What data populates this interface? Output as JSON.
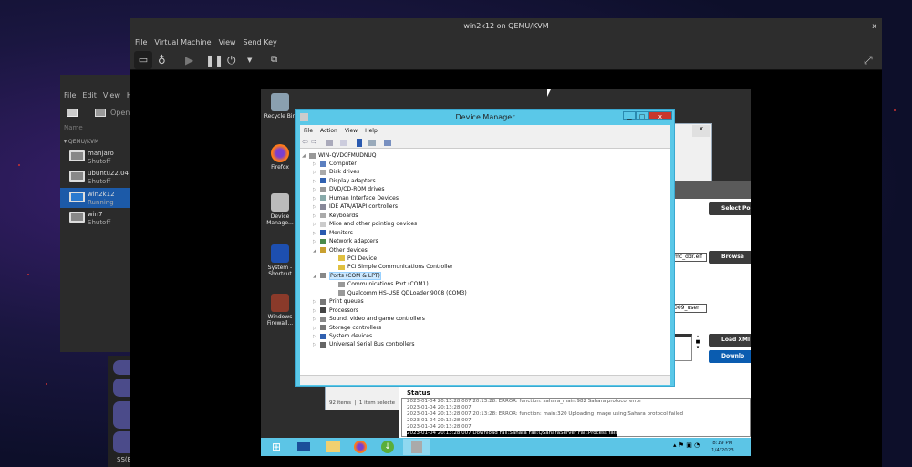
{
  "virt_manager": {
    "menu": [
      "File",
      "Edit",
      "View",
      "H"
    ],
    "open_label": "Open",
    "name_header": "Name",
    "group": "QEMU/KVM",
    "vms": [
      {
        "name": "manjaro",
        "state": "Shutoff"
      },
      {
        "name": "ubuntu22.04",
        "state": "Shutoff"
      },
      {
        "name": "win2k12",
        "state": "Running",
        "selected": true
      },
      {
        "name": "win7",
        "state": "Shutoff"
      }
    ]
  },
  "dock": {
    "label": "SS(E"
  },
  "viewer": {
    "title": "win2k12 on QEMU/KVM",
    "close": "x",
    "menu": [
      "File",
      "Virtual Machine",
      "View",
      "Send Key"
    ],
    "toolbar": [
      "monitor-icon",
      "lightbulb-icon",
      "play-icon",
      "pause-icon",
      "power-icon",
      "dropdown-icon",
      "screenshot-icon",
      "fullscreen-icon"
    ]
  },
  "guest": {
    "desktop_icons": [
      "Recycle Bin",
      "Firefox",
      "Device Manage...",
      "System - Shortcut",
      "Windows Firewall..."
    ],
    "explorer": {
      "items_count": "92 items",
      "selected": "1 item selecte"
    },
    "tool": {
      "select_port": "Select Po",
      "browse": "Browse",
      "load_xml": "Load XMl",
      "download": "Downlo",
      "field1": "mc_ddr.elf",
      "field2": "009_user",
      "status_title": "Status",
      "status_lines": [
        "2023-01-04 20:13:28.007    20:13:28: ERROR: function: sahara_main:982 Sahara protocol error",
        "2023-01-04 20:13:28.007",
        "2023-01-04 20:13:28.007    20:13:28: ERROR: function: main:320 Uploading  Image using Sahara protocol failed",
        "2023-01-04 20:13:28.007",
        "2023-01-04 20:13:28.007"
      ],
      "status_highlight": "2023-01-04 20:13:28.007    Download Fail:Sahara Fail:QSaharaServer Fail:Process fail"
    },
    "device_manager": {
      "title": "Device Manager",
      "menu": [
        "File",
        "Action",
        "View",
        "Help"
      ],
      "root": "WIN-QVDCFMUDNUQ",
      "tree": [
        {
          "label": "Computer",
          "level": 1,
          "exp": "▷"
        },
        {
          "label": "Disk drives",
          "level": 1,
          "exp": "▷"
        },
        {
          "label": "Display adapters",
          "level": 1,
          "exp": "▷"
        },
        {
          "label": "DVD/CD-ROM drives",
          "level": 1,
          "exp": "▷"
        },
        {
          "label": "Human Interface Devices",
          "level": 1,
          "exp": "▷"
        },
        {
          "label": "IDE ATA/ATAPI controllers",
          "level": 1,
          "exp": "▷"
        },
        {
          "label": "Keyboards",
          "level": 1,
          "exp": "▷"
        },
        {
          "label": "Mice and other pointing devices",
          "level": 1,
          "exp": "▷"
        },
        {
          "label": "Monitors",
          "level": 1,
          "exp": "▷"
        },
        {
          "label": "Network adapters",
          "level": 1,
          "exp": "▷"
        },
        {
          "label": "Other devices",
          "level": 1,
          "exp": "◢"
        },
        {
          "label": "PCI Device",
          "level": 2,
          "exp": ""
        },
        {
          "label": "PCI Simple Communications Controller",
          "level": 2,
          "exp": ""
        },
        {
          "label": "Ports (COM & LPT)",
          "level": 1,
          "exp": "◢",
          "selected": true
        },
        {
          "label": "Communications Port (COM1)",
          "level": 2,
          "exp": ""
        },
        {
          "label": "Qualcomm HS-USB QDLoader 9008 (COM3)",
          "level": 2,
          "exp": ""
        },
        {
          "label": "Print queues",
          "level": 1,
          "exp": "▷"
        },
        {
          "label": "Processors",
          "level": 1,
          "exp": "▷"
        },
        {
          "label": "Sound, video and game controllers",
          "level": 1,
          "exp": "▷"
        },
        {
          "label": "Storage controllers",
          "level": 1,
          "exp": "▷"
        },
        {
          "label": "System devices",
          "level": 1,
          "exp": "▷"
        },
        {
          "label": "Universal Serial Bus controllers",
          "level": 1,
          "exp": "▷"
        }
      ]
    },
    "clock": {
      "time": "8:19 PM",
      "date": "1/4/2023"
    }
  },
  "colors": {
    "accent": "#5ac8e8",
    "selection": "#1c5aa8",
    "download": "#0a5cb0"
  }
}
